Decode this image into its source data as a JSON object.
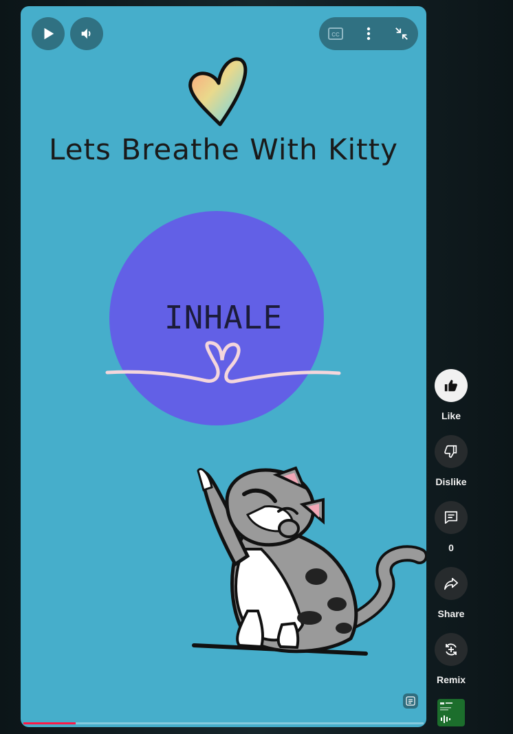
{
  "video": {
    "title_text": "Lets Breathe With Kitty",
    "breath_word": "INHALE",
    "progress_fraction": 0.13
  },
  "controls": {
    "play_icon": "play-icon",
    "volume_icon": "volume-icon",
    "cc_icon": "closed-captions-icon",
    "more_icon": "more-vert-icon",
    "exit_fullscreen_icon": "exit-fullscreen-icon"
  },
  "actions": {
    "like_label": "Like",
    "dislike_label": "Dislike",
    "comments_count": "0",
    "share_label": "Share",
    "remix_label": "Remix"
  },
  "colors": {
    "video_bg": "#46aecb",
    "circle": "#6260e6",
    "progress": "#ff1744"
  }
}
